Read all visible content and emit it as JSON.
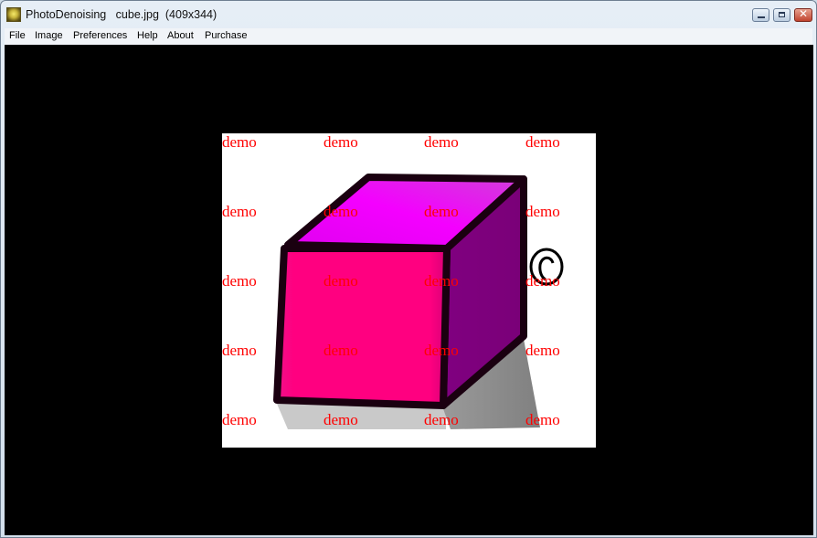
{
  "window": {
    "app_name": "PhotoDenoising",
    "file_name": "cube.jpg",
    "dimensions": "(409x344)",
    "title_text": "PhotoDenoising   cube.jpg  (409x344)",
    "controls": {
      "minimize": "minimize-icon",
      "maximize": "maximize-icon",
      "close": "close-icon",
      "close_glyph": "✕"
    }
  },
  "menu": {
    "items": [
      {
        "label": "File"
      },
      {
        "label": "Image"
      },
      {
        "label": "Preferences"
      },
      {
        "label": "Help"
      },
      {
        "label": "About"
      },
      {
        "label": "Purchase"
      }
    ]
  },
  "image": {
    "subject": "pink-purple cube with shadow",
    "watermark_text": "demo",
    "watermark_color": "#ff0000",
    "colors": {
      "front": "#ff0080",
      "top": "#f000f8",
      "side": "#7a0078",
      "outline": "#1a0010",
      "shadow_light": "#cfcfcf",
      "shadow_dark": "#8a8a8a"
    }
  }
}
